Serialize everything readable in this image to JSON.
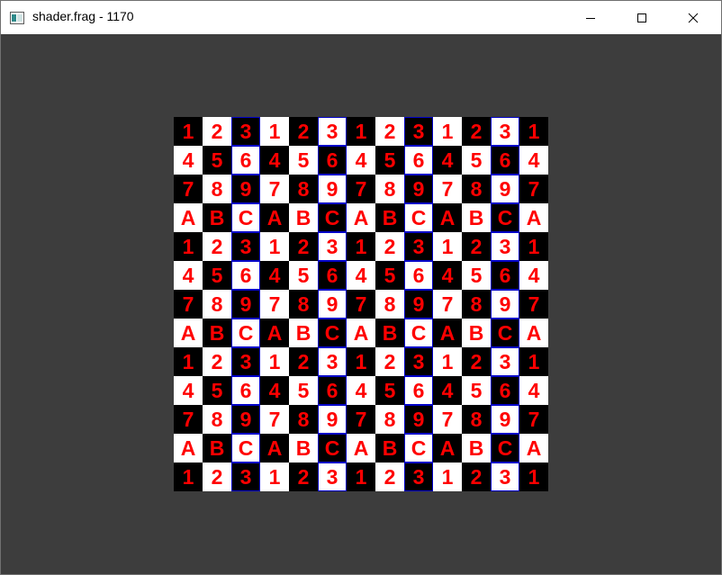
{
  "window": {
    "title": "shader.frag - 1170",
    "icon": "app-window-icon",
    "controls": {
      "minimize": "minimize-icon",
      "maximize": "maximize-icon",
      "close": "close-icon"
    }
  },
  "canvas": {
    "background": "#3d3d3d",
    "tile_pattern": {
      "rows": [
        [
          "1",
          "2",
          "3"
        ],
        [
          "4",
          "5",
          "6"
        ],
        [
          "7",
          "8",
          "9"
        ],
        [
          "A",
          "B",
          "C"
        ]
      ],
      "tiles_per_side": 13,
      "colors": {
        "dark_cell": "#000000",
        "light_cell": "#ffffff",
        "glyph": "#ff0000",
        "border": "#0000c8"
      }
    }
  }
}
